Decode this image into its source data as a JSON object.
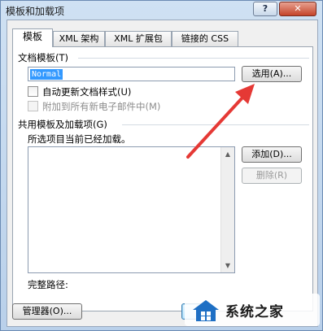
{
  "window": {
    "title": "模板和加载项",
    "help_glyph": "?",
    "close_glyph": "✕"
  },
  "tabs": [
    {
      "label": "模板"
    },
    {
      "label": "XML 架构"
    },
    {
      "label": "XML 扩展包"
    },
    {
      "label": "链接的 CSS"
    }
  ],
  "document_template": {
    "group_label": "文档模板(T)",
    "value": "Normal",
    "attach_button": "选用(A)...",
    "auto_update_label": "自动更新文档样式(U)",
    "attach_new_email_label": "附加到所有新电子邮件中(M)"
  },
  "global_templates": {
    "group_label": "共用模板及加载项(G)",
    "note": "所选项目当前已经加载。",
    "add_button": "添加(D)...",
    "remove_button": "删除(R)",
    "full_path_label": "完整路径:"
  },
  "footer": {
    "organizer_button": "管理器(O)..."
  },
  "watermark": {
    "text": "系统之家"
  },
  "colors": {
    "selection": "#3399ff",
    "arrow": "#e53935",
    "titlebar": "#c9dcef"
  }
}
